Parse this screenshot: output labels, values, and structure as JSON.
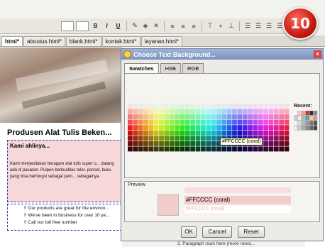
{
  "toolbar": {
    "buttons": [
      "B",
      "I",
      "U"
    ]
  },
  "file_tabs": [
    "html*",
    "aboutus.html*",
    "blank.html*",
    "kontak.html*",
    "layanan.html*"
  ],
  "editor": {
    "heading": "Produsen Alat Tulis Beken...",
    "selected_title": "Kami ahlinya...",
    "selected_body": "Kami menyediakan beragam alat tulis super o... datang ada di pasaran. Pulpen berkualitas telor. ponsel, buku yang bisa berfungsi sebagai pem... sebagainya.",
    "bullets": [
      "!! Our products are great for the environ...",
      "!! We've been in business for over 10 ye...",
      "!! Call our toll free number"
    ]
  },
  "dialog": {
    "title": "Choose Text Background...",
    "tabs": [
      "Swatches",
      "HSB",
      "RGB"
    ],
    "recent_label": "Recent:",
    "tooltip": "#FFCCCC (coral)",
    "preview_label": "Preview",
    "preview_sample": "#FFCCCC (coral)",
    "preview_faded": "#FFCCCC (coral)",
    "ok_label": "OK",
    "cancel_label": "Cancel",
    "reset_label": "Reset",
    "selected_color": "#FFCCCC"
  },
  "footer_text": "2. Paragraph rows here (more rows)...",
  "badge": "10"
}
